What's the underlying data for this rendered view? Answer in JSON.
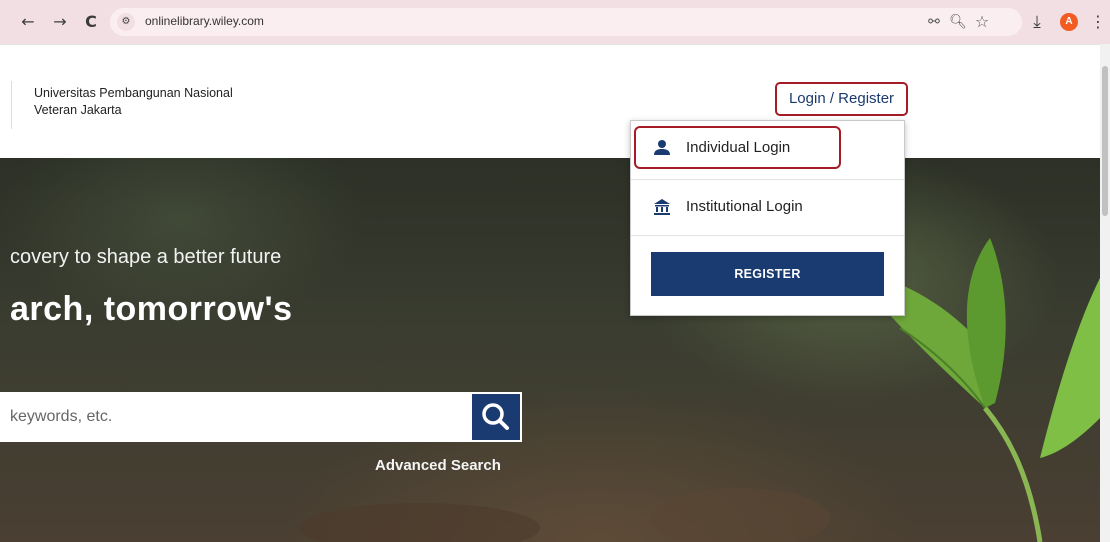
{
  "browser": {
    "back_icon": "←",
    "forward_icon": "→",
    "reload_icon": "C",
    "site_info_icon": "⚙",
    "url": "onlinelibrary.wiley.com",
    "password_icon": "⚯",
    "zoom_icon": "🔍︎",
    "bookmark_icon": "☆",
    "download_icon": "⤓",
    "avatar_letter": "A",
    "menu_icon": "⋮"
  },
  "header": {
    "institution_line1": "Universitas Pembangunan Nasional",
    "institution_line2": "Veteran Jakarta",
    "login_label": "Login / Register"
  },
  "dropdown": {
    "individual_login": "Individual Login",
    "institutional_login": "Institutional Login",
    "register_label": "REGISTER"
  },
  "hero": {
    "subtitle": "covery to shape a better future",
    "title": "arch, tomorrow's",
    "search_placeholder": "keywords, etc.",
    "advanced_search": "Advanced Search"
  },
  "colors": {
    "brand_blue": "#1a3a72",
    "highlight_red": "#a51c26",
    "browser_bar": "#f2dfe4"
  }
}
